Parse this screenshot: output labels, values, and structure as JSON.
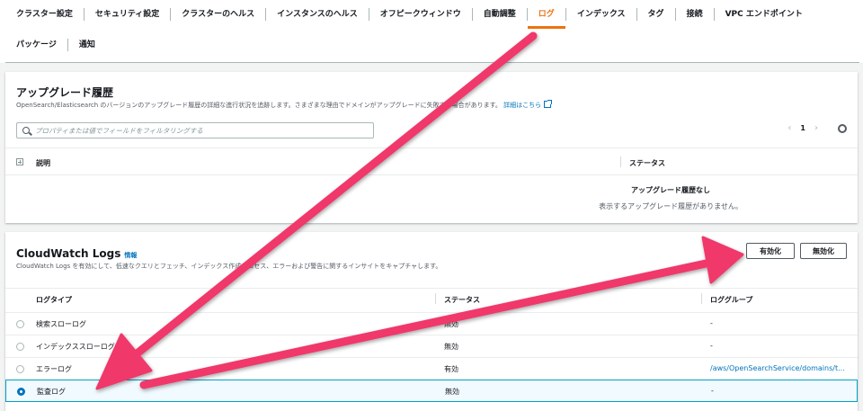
{
  "tabs": {
    "row1": [
      "クラスター設定",
      "セキュリティ設定",
      "クラスターのヘルス",
      "インスタンスのヘルス",
      "オフピークウィンドウ",
      "自動調整",
      "ログ",
      "インデックス",
      "タグ",
      "接続",
      "VPC エンドポイント"
    ],
    "row2": [
      "パッケージ",
      "通知"
    ],
    "active": "ログ"
  },
  "upgrade": {
    "title": "アップグレード履歴",
    "description": "OpenSearch/Elasticsearch のバージョンのアップグレード履歴の詳細な進行状況を追跡します。さまざまな理由でドメインがアップグレードに失敗する場合があります。",
    "learn_more": "詳細はこちら",
    "search_placeholder": "プロパティまたは値でフィールドをフィルタリングする",
    "page": "1",
    "col_description": "説明",
    "col_status": "ステータス",
    "empty_title": "アップグレード履歴なし",
    "empty_desc": "表示するアップグレード履歴がありません。"
  },
  "cloudwatch": {
    "title": "CloudWatch Logs",
    "info": "情報",
    "description": "CloudWatch Logs を有効にして、低速なクエリとフェッチ、インデックス作成プロセス、エラーおよび警告に関するインサイトをキャプチャします。",
    "enable_label": "有効化",
    "disable_label": "無効化",
    "col_type": "ログタイプ",
    "col_status": "ステータス",
    "col_group": "ロググループ",
    "rows": [
      {
        "type": "検索スローログ",
        "status": "無効",
        "group": "-",
        "selected": false
      },
      {
        "type": "インデックススローログ",
        "status": "無効",
        "group": "-",
        "selected": false
      },
      {
        "type": "エラーログ",
        "status": "有効",
        "group": "/aws/OpenSearchService/domains/t...",
        "selected": false
      },
      {
        "type": "監査ログ",
        "status": "無効",
        "group": "-",
        "selected": true
      }
    ]
  },
  "colors": {
    "accent": "#ec7211",
    "link": "#0073bb",
    "annotation_arrow": "#f0386b"
  },
  "icons": [
    "search-icon",
    "chevron-left-icon",
    "chevron-right-icon",
    "gear-icon",
    "external-link-icon",
    "expand-icon",
    "radio-button"
  ]
}
